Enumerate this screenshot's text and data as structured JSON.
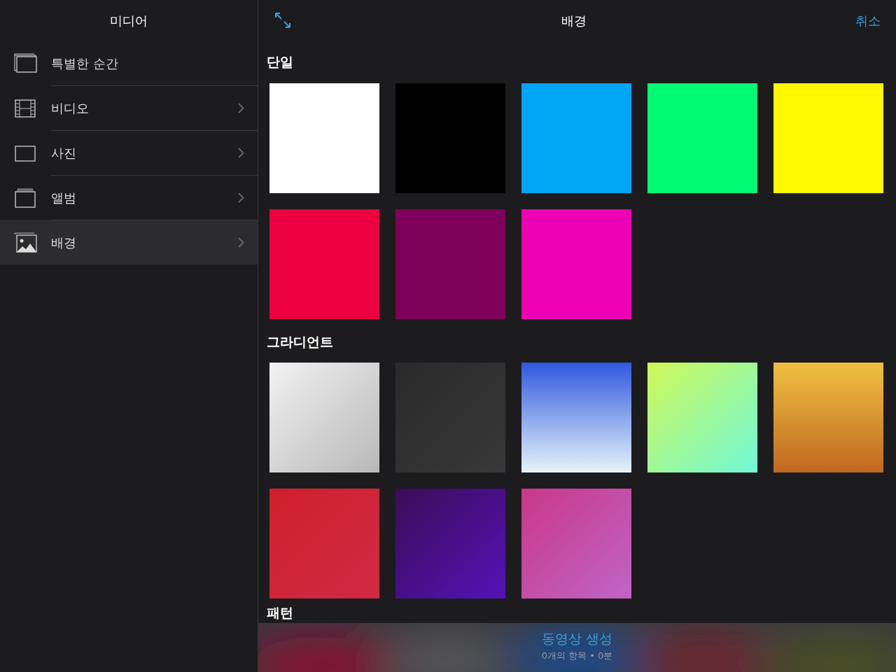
{
  "sidebar": {
    "title": "미디어",
    "items": [
      {
        "label": "특별한 순간",
        "chevron": false,
        "selected": false
      },
      {
        "label": "비디오",
        "chevron": true,
        "selected": false
      },
      {
        "label": "사진",
        "chevron": true,
        "selected": false
      },
      {
        "label": "앨범",
        "chevron": true,
        "selected": false
      },
      {
        "label": "배경",
        "chevron": true,
        "selected": true
      }
    ]
  },
  "header": {
    "title": "배경",
    "cancel": "취소"
  },
  "sections": [
    {
      "title": "단일",
      "swatches": [
        {
          "kind": "solid",
          "color": "#ffffff"
        },
        {
          "kind": "solid",
          "color": "#000000"
        },
        {
          "kind": "solid",
          "color": "#00a5f5"
        },
        {
          "kind": "solid",
          "color": "#00fb73"
        },
        {
          "kind": "solid",
          "color": "#fff800"
        },
        {
          "kind": "solid",
          "color": "#ec0040"
        },
        {
          "kind": "solid",
          "color": "#7e005a"
        },
        {
          "kind": "solid",
          "color": "#ed00b4"
        }
      ]
    },
    {
      "title": "그라디언트",
      "swatches": [
        {
          "kind": "diagonal",
          "color": "#f2f2f2"
        },
        {
          "kind": "diagonal",
          "color": "#2a2a2a"
        },
        {
          "kind": "vertical",
          "color": "#3058e0"
        },
        {
          "kind": "diagonal",
          "color": "#d0f858"
        },
        {
          "kind": "vertical",
          "color": "#f0c040"
        },
        {
          "kind": "diagonal",
          "color": "#d01f2c"
        },
        {
          "kind": "diagonal",
          "color": "#3c0c58"
        },
        {
          "kind": "diagonal",
          "color": "#c83888"
        }
      ]
    },
    {
      "title": "패턴"
    }
  ],
  "footer": {
    "title": "동영상 생성",
    "subtitle": "0개의 항목 • 0분"
  }
}
